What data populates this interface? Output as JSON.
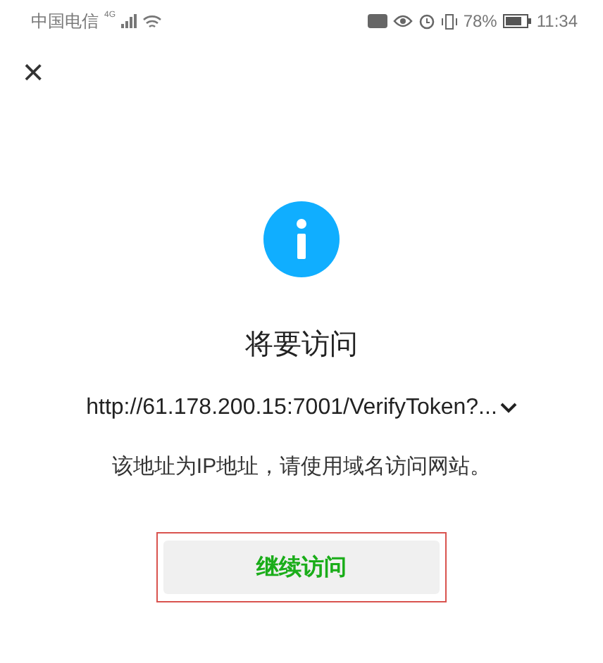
{
  "status_bar": {
    "carrier": "中国电信",
    "network": "4G",
    "battery": "78%",
    "time": "11:34"
  },
  "close": "×",
  "dialog": {
    "title": "将要访问",
    "url": "http://61.178.200.15:7001/VerifyToken?...",
    "note": "该地址为IP地址，请使用域名访问网站。",
    "button": {
      "label": "继续访问",
      "highlighted": true
    }
  }
}
